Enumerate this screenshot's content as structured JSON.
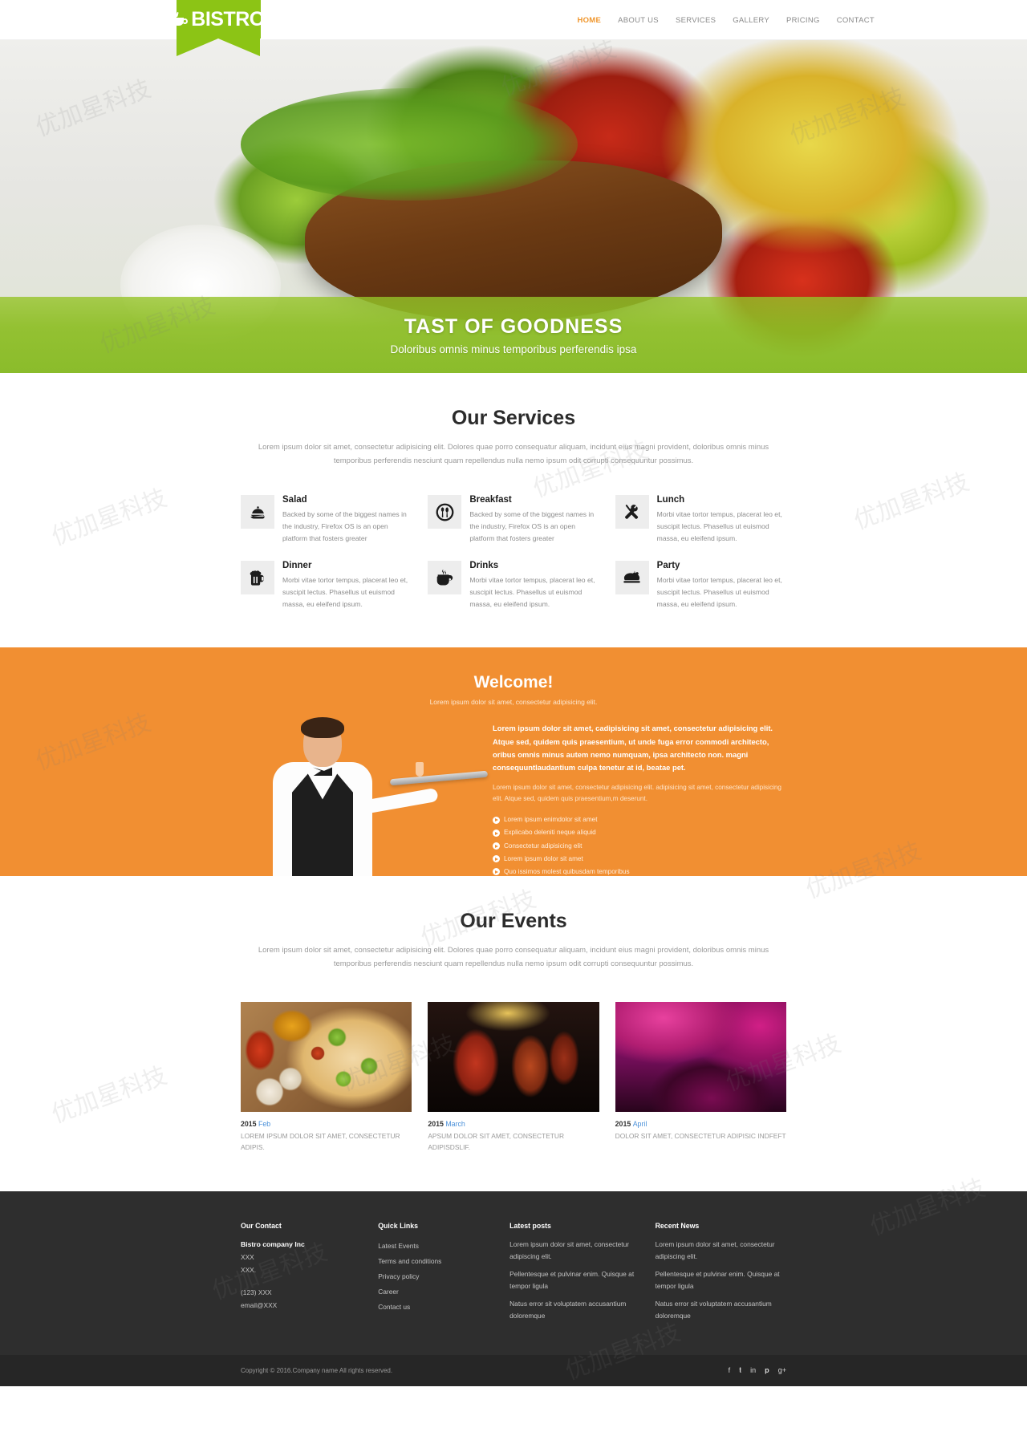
{
  "header": {
    "logo_text": "BISTRO",
    "logo_icon": "coffee-cup-icon",
    "nav": [
      {
        "label": "HOME",
        "active": true
      },
      {
        "label": "ABOUT US",
        "active": false
      },
      {
        "label": "SERVICES",
        "active": false
      },
      {
        "label": "GALLERY",
        "active": false
      },
      {
        "label": "PRICING",
        "active": false
      },
      {
        "label": "CONTACT",
        "active": false
      }
    ]
  },
  "hero": {
    "title": "TAST OF GOODNESS",
    "subtitle": "Doloribus omnis minus temporibus perferendis ipsa"
  },
  "services": {
    "title": "Our Services",
    "subtitle": "Lorem ipsum dolor sit amet, consectetur adipisicing elit. Dolores quae porro consequatur aliquam, incidunt eius magni provident, doloribus omnis minus temporibus perferendis nesciunt quam repellendus nulla nemo ipsum odit corrupti consequuntur possimus.",
    "items": [
      {
        "icon": "cloche-service-icon",
        "title": "Salad",
        "desc": "Backed by some of the biggest names in the industry, Firefox OS is an open platform that fosters greater"
      },
      {
        "icon": "plate-cutlery-icon",
        "title": "Breakfast",
        "desc": "Backed by some of the biggest names in the industry, Firefox OS is an open platform that fosters greater"
      },
      {
        "icon": "fork-knife-cross-icon",
        "title": "Lunch",
        "desc": "Morbi vitae tortor tempus, placerat leo et, suscipit lectus. Phasellus ut euismod massa, eu eleifend ipsum."
      },
      {
        "icon": "beer-mug-icon",
        "title": "Dinner",
        "desc": "Morbi vitae tortor tempus, placerat leo et, suscipit lectus. Phasellus ut euismod massa, eu eleifend ipsum."
      },
      {
        "icon": "coffee-cup-hot-icon",
        "title": "Drinks",
        "desc": "Morbi vitae tortor tempus, placerat leo et, suscipit lectus. Phasellus ut euismod massa, eu eleifend ipsum."
      },
      {
        "icon": "roast-turkey-icon",
        "title": "Party",
        "desc": "Morbi vitae tortor tempus, placerat leo et, suscipit lectus. Phasellus ut euismod massa, eu eleifend ipsum."
      }
    ]
  },
  "welcome": {
    "title": "Welcome!",
    "subtitle": "Lorem ipsum dolor sit amet, consectetur adipisicing elit.",
    "lead": "Lorem ipsum dolor sit amet, cadipisicing sit amet, consectetur adipisicing elit. Atque sed, quidem quis praesentium, ut unde fuga error commodi architecto, oribus omnis minus autem nemo numquam, ipsa architecto non. magni consequuntlaudantium culpa tenetur at id, beatae pet.",
    "body": "Lorem ipsum dolor sit amet, consectetur adipisicing elit. adipisicing sit amet, consectetur adipisicing elit. Atque sed, quidem quis praesentium,m deserunt.",
    "bullets": [
      "Lorem ipsum enimdolor sit amet",
      "Explicabo deleniti neque aliquid",
      "Consectetur adipisicing elit",
      "Lorem ipsum dolor sit amet",
      "Quo issimos molest quibusdam temporibus"
    ],
    "image": "waiter-with-tray-photo"
  },
  "events": {
    "title": "Our Events",
    "subtitle": "Lorem ipsum dolor sit amet, consectetur adipisicing elit. Dolores quae porro consequatur aliquam, incidunt eius magni provident, doloribus omnis minus temporibus perferendis nesciunt quam repellendus nulla nemo ipsum odit corrupti consequuntur possimus.",
    "cards": [
      {
        "image": "pizza-photo",
        "year": "2015",
        "month": "Feb",
        "desc": "LOREM IPSUM DOLOR SIT AMET, CONSECTETUR ADIPIS."
      },
      {
        "image": "live-band-photo",
        "year": "2015",
        "month": "March",
        "desc": "APSUM DOLOR SIT AMET, CONSECTETUR ADIPISDSLIF."
      },
      {
        "image": "dance-party-photo",
        "year": "2015",
        "month": "April",
        "desc": "DOLOR SIT AMET, CONSECTETUR ADIPISIC INDFEFT"
      }
    ]
  },
  "footer": {
    "contact": {
      "title": "Our Contact",
      "company": "Bistro company Inc",
      "addr1": "XXX",
      "addr2": "XXX.",
      "phone": "(123) XXX",
      "email": "email@XXX"
    },
    "quick_links": {
      "title": "Quick Links",
      "links": [
        "Latest Events",
        "Terms and conditions",
        "Privacy policy",
        "Career",
        "Contact us"
      ]
    },
    "latest_posts": {
      "title": "Latest posts",
      "posts": [
        "Lorem ipsum dolor sit amet, consectetur adipiscing elit.",
        "Pellentesque et pulvinar enim. Quisque at tempor ligula",
        "Natus error sit voluptatem accusantium doloremque"
      ]
    },
    "recent_news": {
      "title": "Recent News",
      "posts": [
        "Lorem ipsum dolor sit amet, consectetur adipiscing elit.",
        "Pellentesque et pulvinar enim. Quisque at tempor ligula",
        "Natus error sit voluptatem accusantium doloremque"
      ]
    },
    "copyright": "Copyright © 2016.Company name All rights reserved.",
    "socials": [
      "facebook-icon",
      "twitter-icon",
      "linkedin-icon",
      "pinterest-icon",
      "google-plus-icon"
    ]
  },
  "colors": {
    "brand_green": "#8cc415",
    "accent_orange": "#f0962c",
    "welcome_bg": "#f18f32",
    "footer_bg": "#2e2e2e",
    "link_blue": "#4a90d9"
  }
}
